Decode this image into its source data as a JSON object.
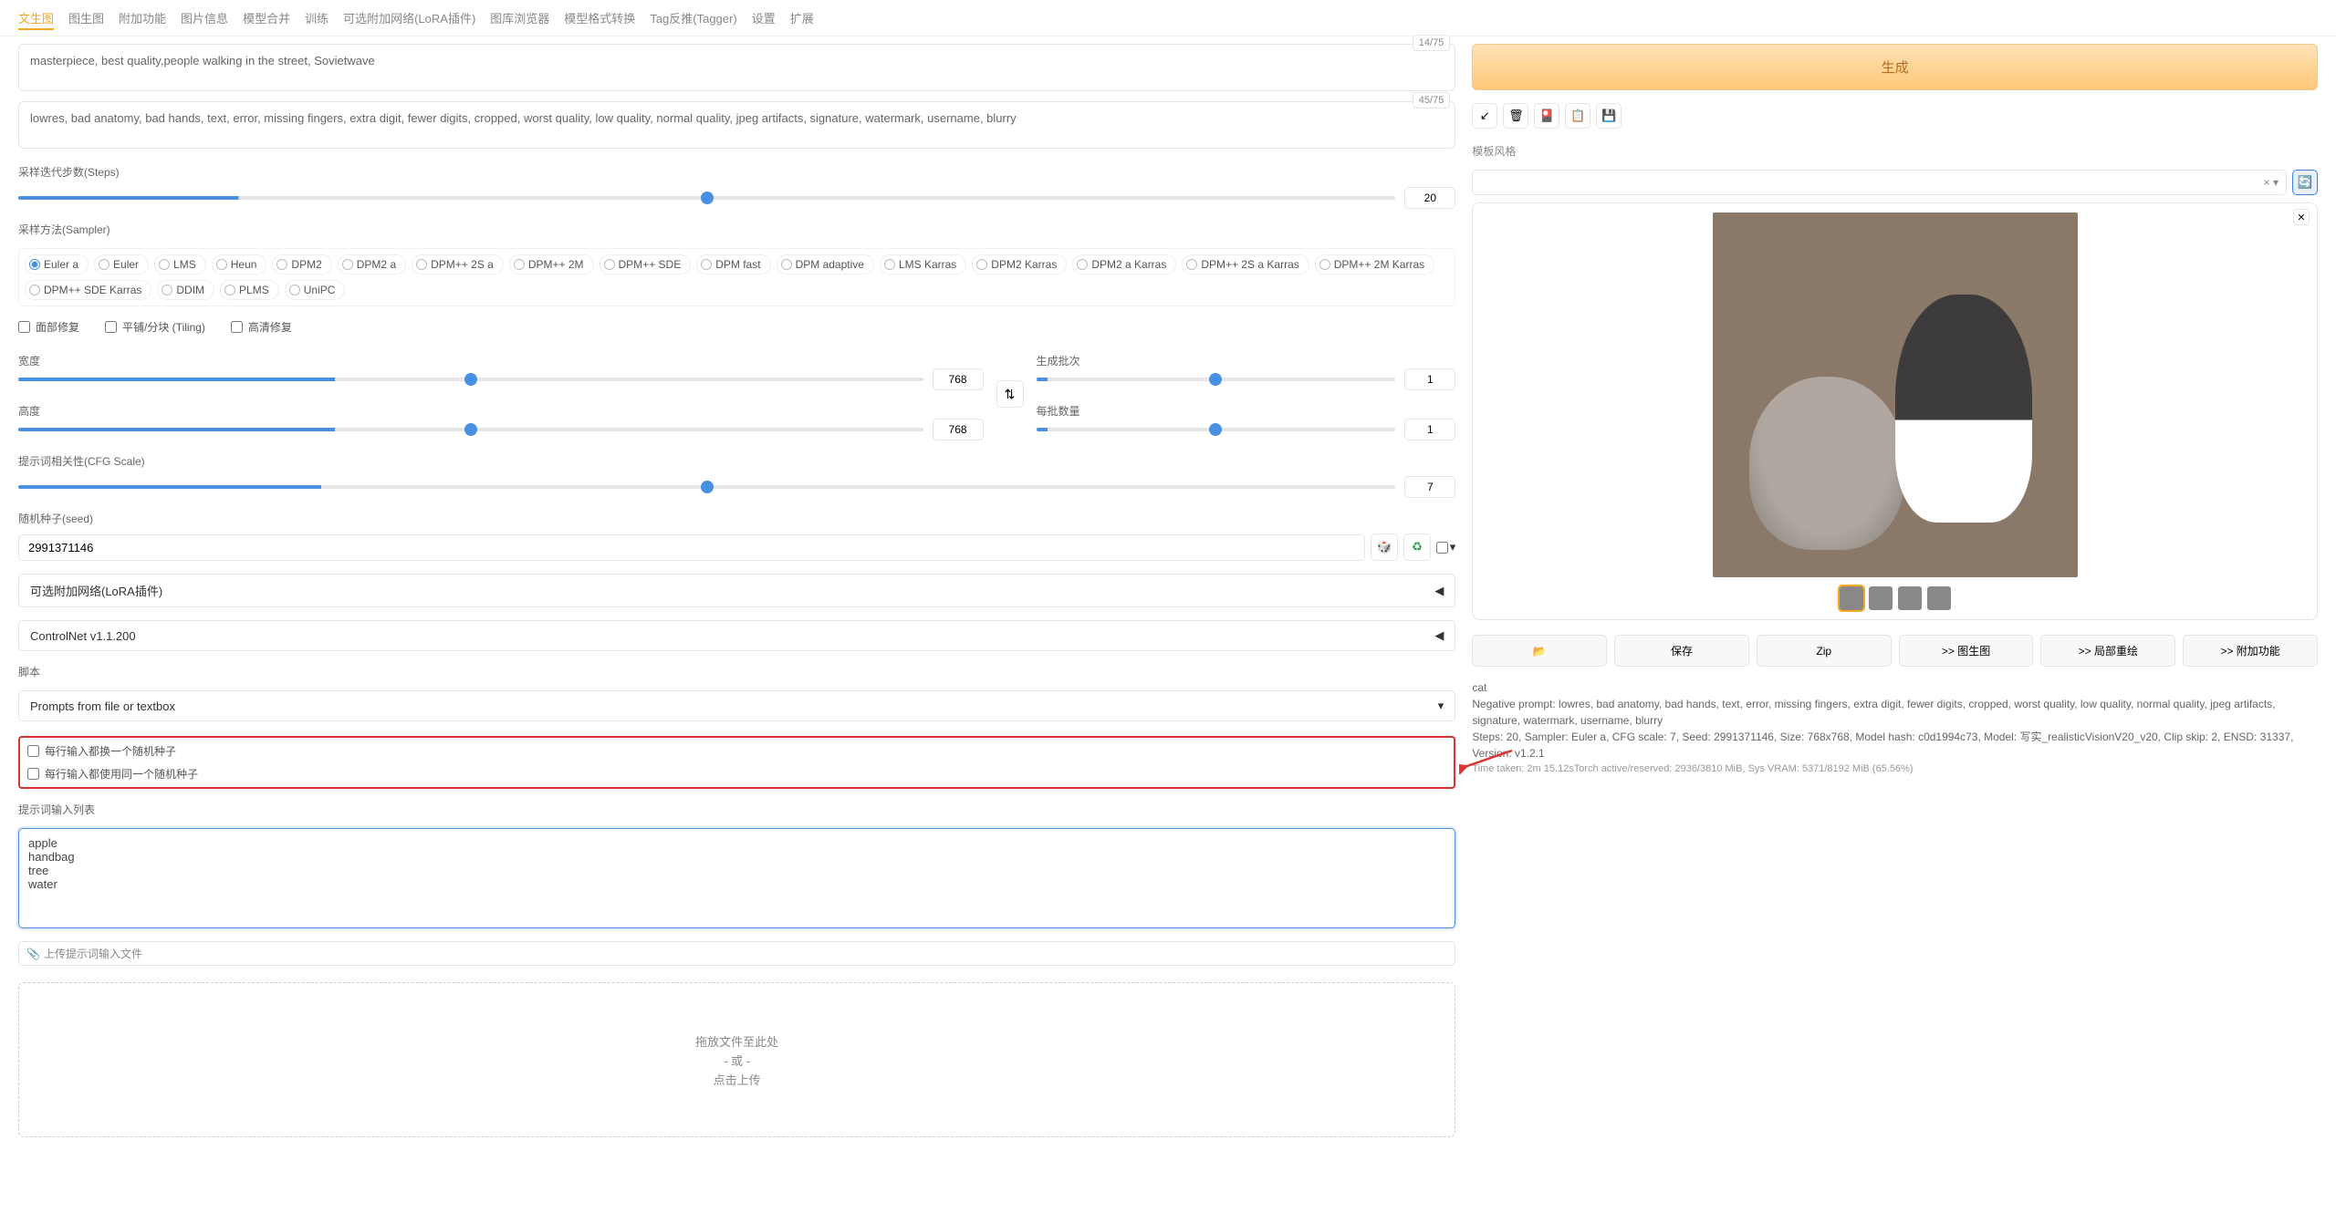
{
  "tabs": [
    "文生图",
    "图生图",
    "附加功能",
    "图片信息",
    "模型合并",
    "训练",
    "可选附加网络(LoRA插件)",
    "图库浏览器",
    "模型格式转换",
    "Tag反推(Tagger)",
    "设置",
    "扩展"
  ],
  "active_tab": 0,
  "prompt": {
    "positive": "masterpiece, best quality,people walking in the street, Sovietwave",
    "pos_tokens": "14/75",
    "negative": "lowres, bad anatomy, bad hands, text, error, missing fingers, extra digit, fewer digits, cropped, worst quality, low quality, normal quality, jpeg artifacts, signature, watermark, username, blurry",
    "neg_tokens": "45/75"
  },
  "generate_label": "生成",
  "style_label": "模板风格",
  "style_clear": "× ▾",
  "steps": {
    "label": "采样迭代步数(Steps)",
    "value": "20"
  },
  "sampler": {
    "label": "采样方法(Sampler)",
    "items": [
      "Euler a",
      "Euler",
      "LMS",
      "Heun",
      "DPM2",
      "DPM2 a",
      "DPM++ 2S a",
      "DPM++ 2M",
      "DPM++ SDE",
      "DPM fast",
      "DPM adaptive",
      "LMS Karras",
      "DPM2 Karras",
      "DPM2 a Karras",
      "DPM++ 2S a Karras",
      "DPM++ 2M Karras",
      "DPM++ SDE Karras",
      "DDIM",
      "PLMS",
      "UniPC"
    ],
    "selected": 0
  },
  "checks": {
    "face": "面部修复",
    "tiling": "平铺/分块 (Tiling)",
    "hires": "高清修复"
  },
  "width": {
    "label": "宽度",
    "value": "768"
  },
  "height": {
    "label": "高度",
    "value": "768"
  },
  "batch_count": {
    "label": "生成批次",
    "value": "1"
  },
  "batch_size": {
    "label": "每批数量",
    "value": "1"
  },
  "cfg": {
    "label": "提示词相关性(CFG Scale)",
    "value": "7"
  },
  "seed": {
    "label": "随机种子(seed)",
    "value": "2991371146"
  },
  "accordion1": "可选附加网络(LoRA插件)",
  "accordion2": "ControlNet v1.1.200",
  "script": {
    "label": "脚本",
    "selected": "Prompts from file or textbox"
  },
  "script_checks": {
    "a": "每行输入都换一个随机种子",
    "b": "每行输入都使用同一个随机种子"
  },
  "prompt_list_label": "提示词输入列表",
  "prompt_list": "apple\nhandbag\ntree\nwater",
  "upload_label": "上传提示词输入文件",
  "dropzone": {
    "l1": "拖放文件至此处",
    "l2": "- 或 -",
    "l3": "点击上传"
  },
  "actions": {
    "folder": "📂",
    "save": "保存",
    "zip": "Zip",
    "img2img": ">> 图生图",
    "inpaint": ">> 局部重绘",
    "extras": ">> 附加功能"
  },
  "meta": {
    "prompt_line": "cat",
    "neg_line": "Negative prompt: lowres, bad anatomy, bad hands, text, error, missing fingers, extra digit, fewer digits, cropped, worst quality, low quality, normal quality, jpeg artifacts, signature, watermark, username, blurry",
    "params": "Steps: 20, Sampler: Euler a, CFG scale: 7, Seed: 2991371146, Size: 768x768, Model hash: c0d1994c73, Model: 写实_realisticVisionV20_v20, Clip skip: 2, ENSD: 31337, Version: v1.2.1",
    "time": "Time taken: 2m 15.12sTorch active/reserved: 2936/3810 MiB, Sys VRAM: 5371/8192 MiB (65.56%)"
  }
}
